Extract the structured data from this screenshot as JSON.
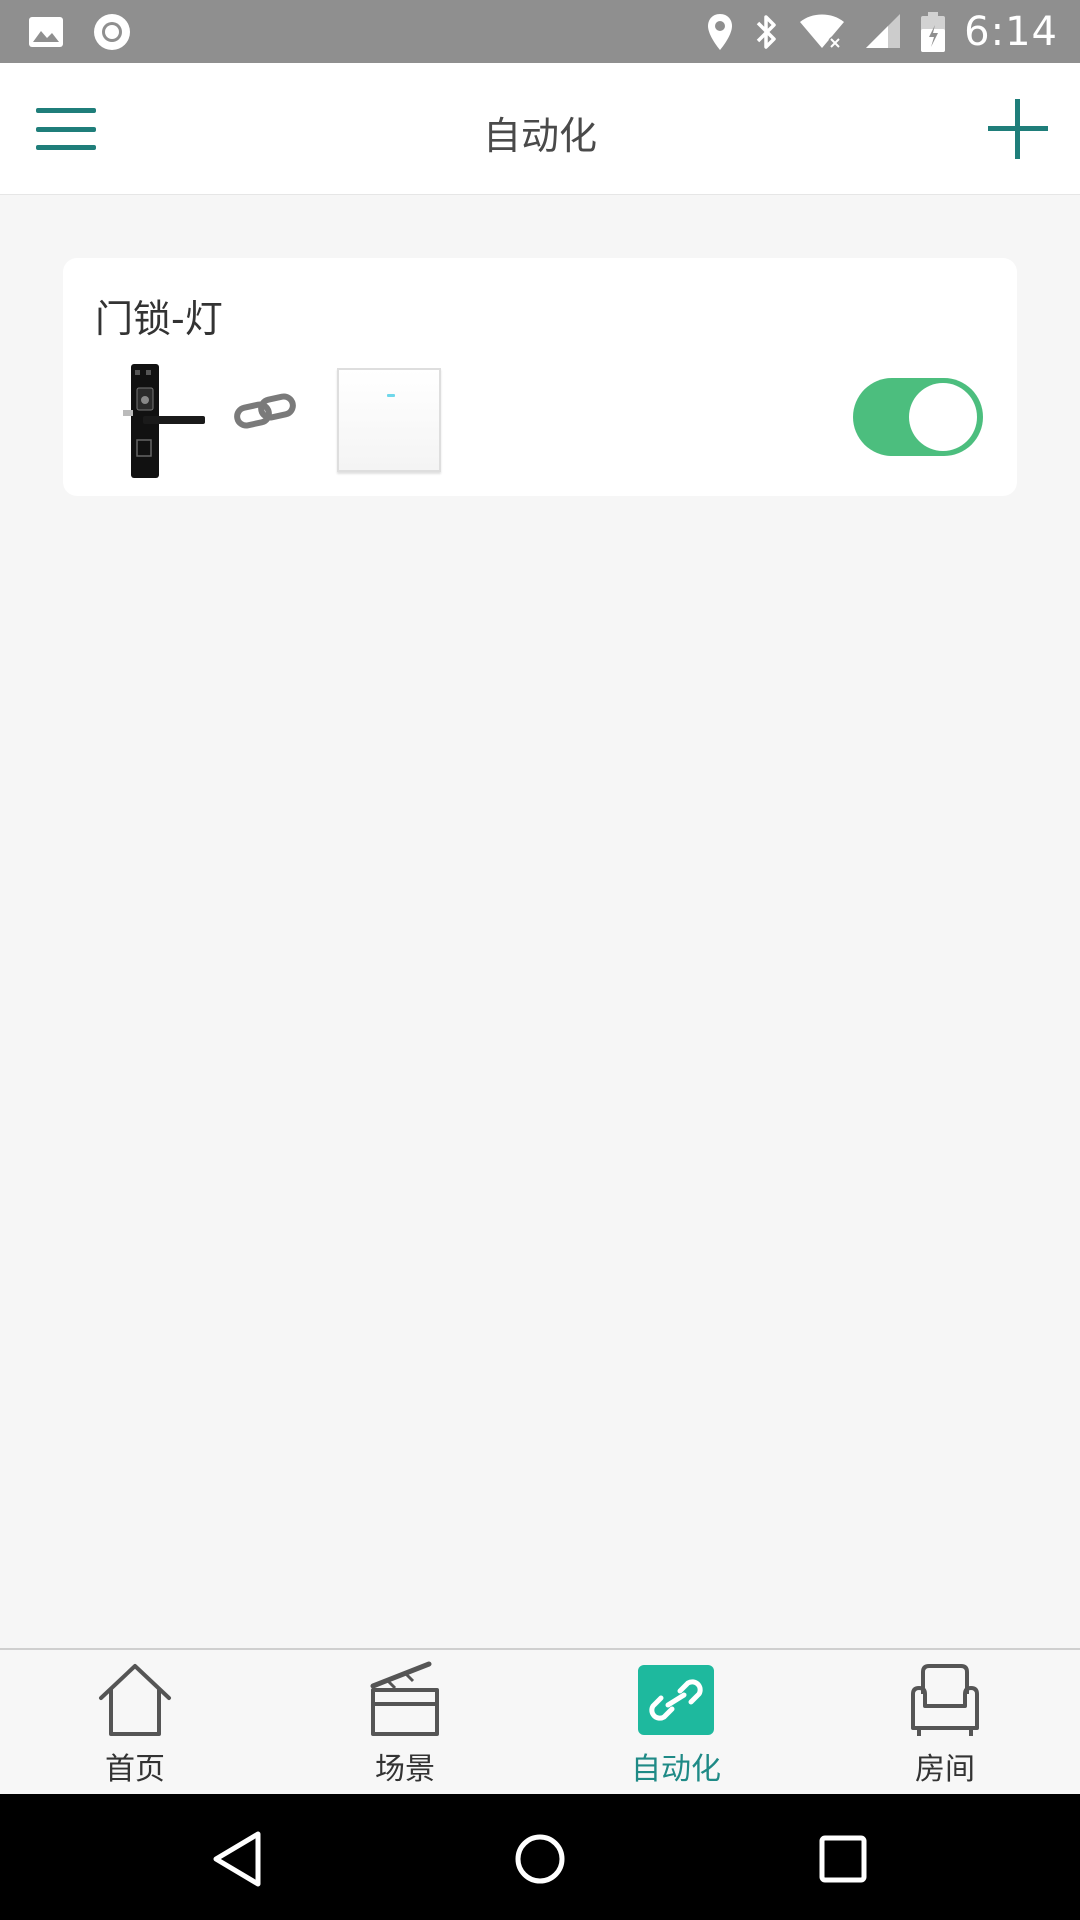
{
  "status_bar": {
    "time": "6:14",
    "icons": [
      "image-icon",
      "record-icon",
      "location-icon",
      "bluetooth-icon",
      "wifi-icon",
      "signal-icon",
      "battery-icon"
    ]
  },
  "app_bar": {
    "title": "自动化",
    "accent_color": "#1f7e7a"
  },
  "automations": [
    {
      "name": "门锁-灯",
      "trigger_device_icon": "door-lock-icon",
      "link_icon": "link-icon",
      "target_device_icon": "wall-switch-icon",
      "enabled": true,
      "toggle_color": "#4cbe7e"
    }
  ],
  "bottom_nav": {
    "items": [
      {
        "label": "首页",
        "icon": "home-icon",
        "active": false
      },
      {
        "label": "场景",
        "icon": "clapperboard-icon",
        "active": false
      },
      {
        "label": "自动化",
        "icon": "link-icon",
        "active": true
      },
      {
        "label": "房间",
        "icon": "sofa-icon",
        "active": false
      }
    ],
    "active_color": "#1eb99e"
  },
  "system_nav": {
    "buttons": [
      "back-icon",
      "home-circle-icon",
      "recents-icon"
    ]
  }
}
